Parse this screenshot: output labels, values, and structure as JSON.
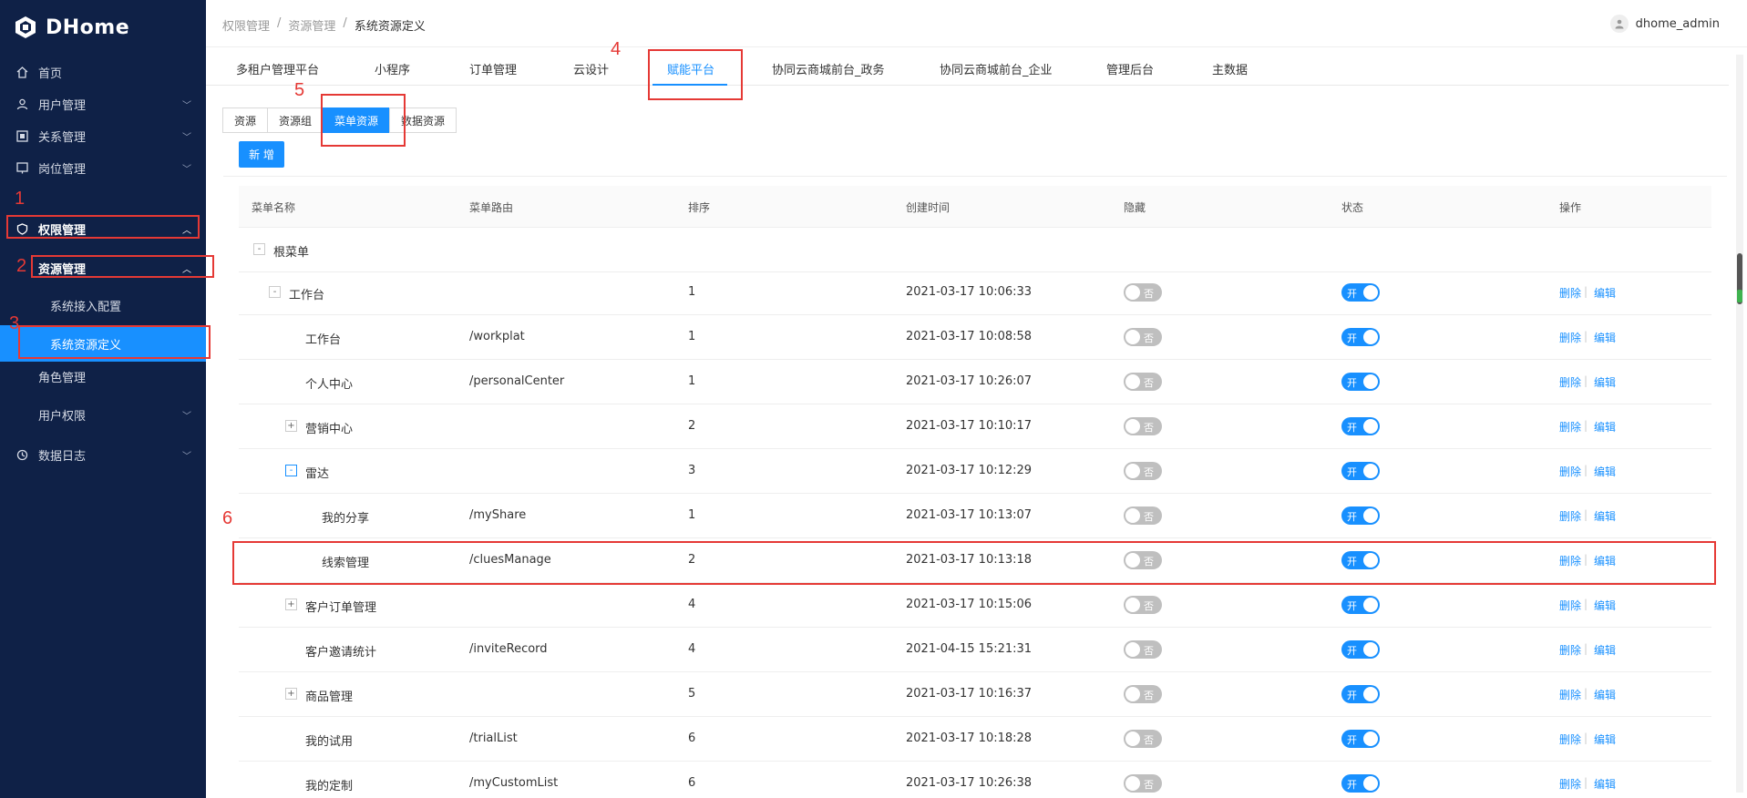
{
  "app": {
    "name": "DHome"
  },
  "sidebar": {
    "items": [
      {
        "label": "首页",
        "icon": "home-icon"
      },
      {
        "label": "用户管理",
        "icon": "user-icon"
      },
      {
        "label": "关系管理",
        "icon": "relation-icon"
      },
      {
        "label": "岗位管理",
        "icon": "post-icon"
      },
      {
        "label": "权限管理",
        "icon": "shield-icon"
      },
      {
        "label": "资源管理"
      },
      {
        "label": "系统接入配置"
      },
      {
        "label": "系统资源定义"
      },
      {
        "label": "角色管理"
      },
      {
        "label": "用户权限"
      },
      {
        "label": "数据日志",
        "icon": "log-icon"
      }
    ]
  },
  "header": {
    "breadcrumb": [
      "权限管理",
      "资源管理",
      "系统资源定义"
    ],
    "separator": "/",
    "username": "dhome_admin"
  },
  "main_tabs": [
    "多租户管理平台",
    "小程序",
    "订单管理",
    "云设计",
    "赋能平台",
    "协同云商城前台_政务",
    "协同云商城前台_企业",
    "管理后台",
    "主数据"
  ],
  "sub_tabs": [
    "资源",
    "资源组",
    "菜单资源",
    "数据资源"
  ],
  "add_button": "新 增",
  "table": {
    "headers": [
      "菜单名称",
      "菜单路由",
      "排序",
      "创建时间",
      "隐藏",
      "状态",
      "操作"
    ],
    "switch_off": "否",
    "switch_on": "开",
    "delete_label": "删除",
    "edit_label": "编辑",
    "rows": [
      {
        "name": "根菜单",
        "route": "",
        "order": "",
        "created": "",
        "expander": "-"
      },
      {
        "name": "工作台",
        "route": "",
        "order": "1",
        "created": "2021-03-17 10:06:33",
        "expander": "-"
      },
      {
        "name": "工作台",
        "route": "/workplat",
        "order": "1",
        "created": "2021-03-17 10:08:58"
      },
      {
        "name": "个人中心",
        "route": "/personalCenter",
        "order": "1",
        "created": "2021-03-17 10:26:07"
      },
      {
        "name": "营销中心",
        "route": "",
        "order": "2",
        "created": "2021-03-17 10:10:17",
        "expander": "+"
      },
      {
        "name": "雷达",
        "route": "",
        "order": "3",
        "created": "2021-03-17 10:12:29",
        "expander": "-"
      },
      {
        "name": "我的分享",
        "route": "/myShare",
        "order": "1",
        "created": "2021-03-17 10:13:07"
      },
      {
        "name": "线索管理",
        "route": "/cluesManage",
        "order": "2",
        "created": "2021-03-17 10:13:18"
      },
      {
        "name": "客户订单管理",
        "route": "",
        "order": "4",
        "created": "2021-03-17 10:15:06",
        "expander": "+"
      },
      {
        "name": "客户邀请统计",
        "route": "/inviteRecord",
        "order": "4",
        "created": "2021-04-15 15:21:31"
      },
      {
        "name": "商品管理",
        "route": "",
        "order": "5",
        "created": "2021-03-17 10:16:37",
        "expander": "+"
      },
      {
        "name": "我的试用",
        "route": "/trialList",
        "order": "6",
        "created": "2021-03-17 10:18:28"
      },
      {
        "name": "我的定制",
        "route": "/myCustomList",
        "order": "6",
        "created": "2021-03-17 10:26:38"
      }
    ]
  },
  "annotations": [
    "1",
    "2",
    "3",
    "4",
    "5",
    "6"
  ],
  "colors": {
    "sidebar_bg": "#0f2147",
    "primary": "#1890ff",
    "annotation": "#e53935"
  }
}
